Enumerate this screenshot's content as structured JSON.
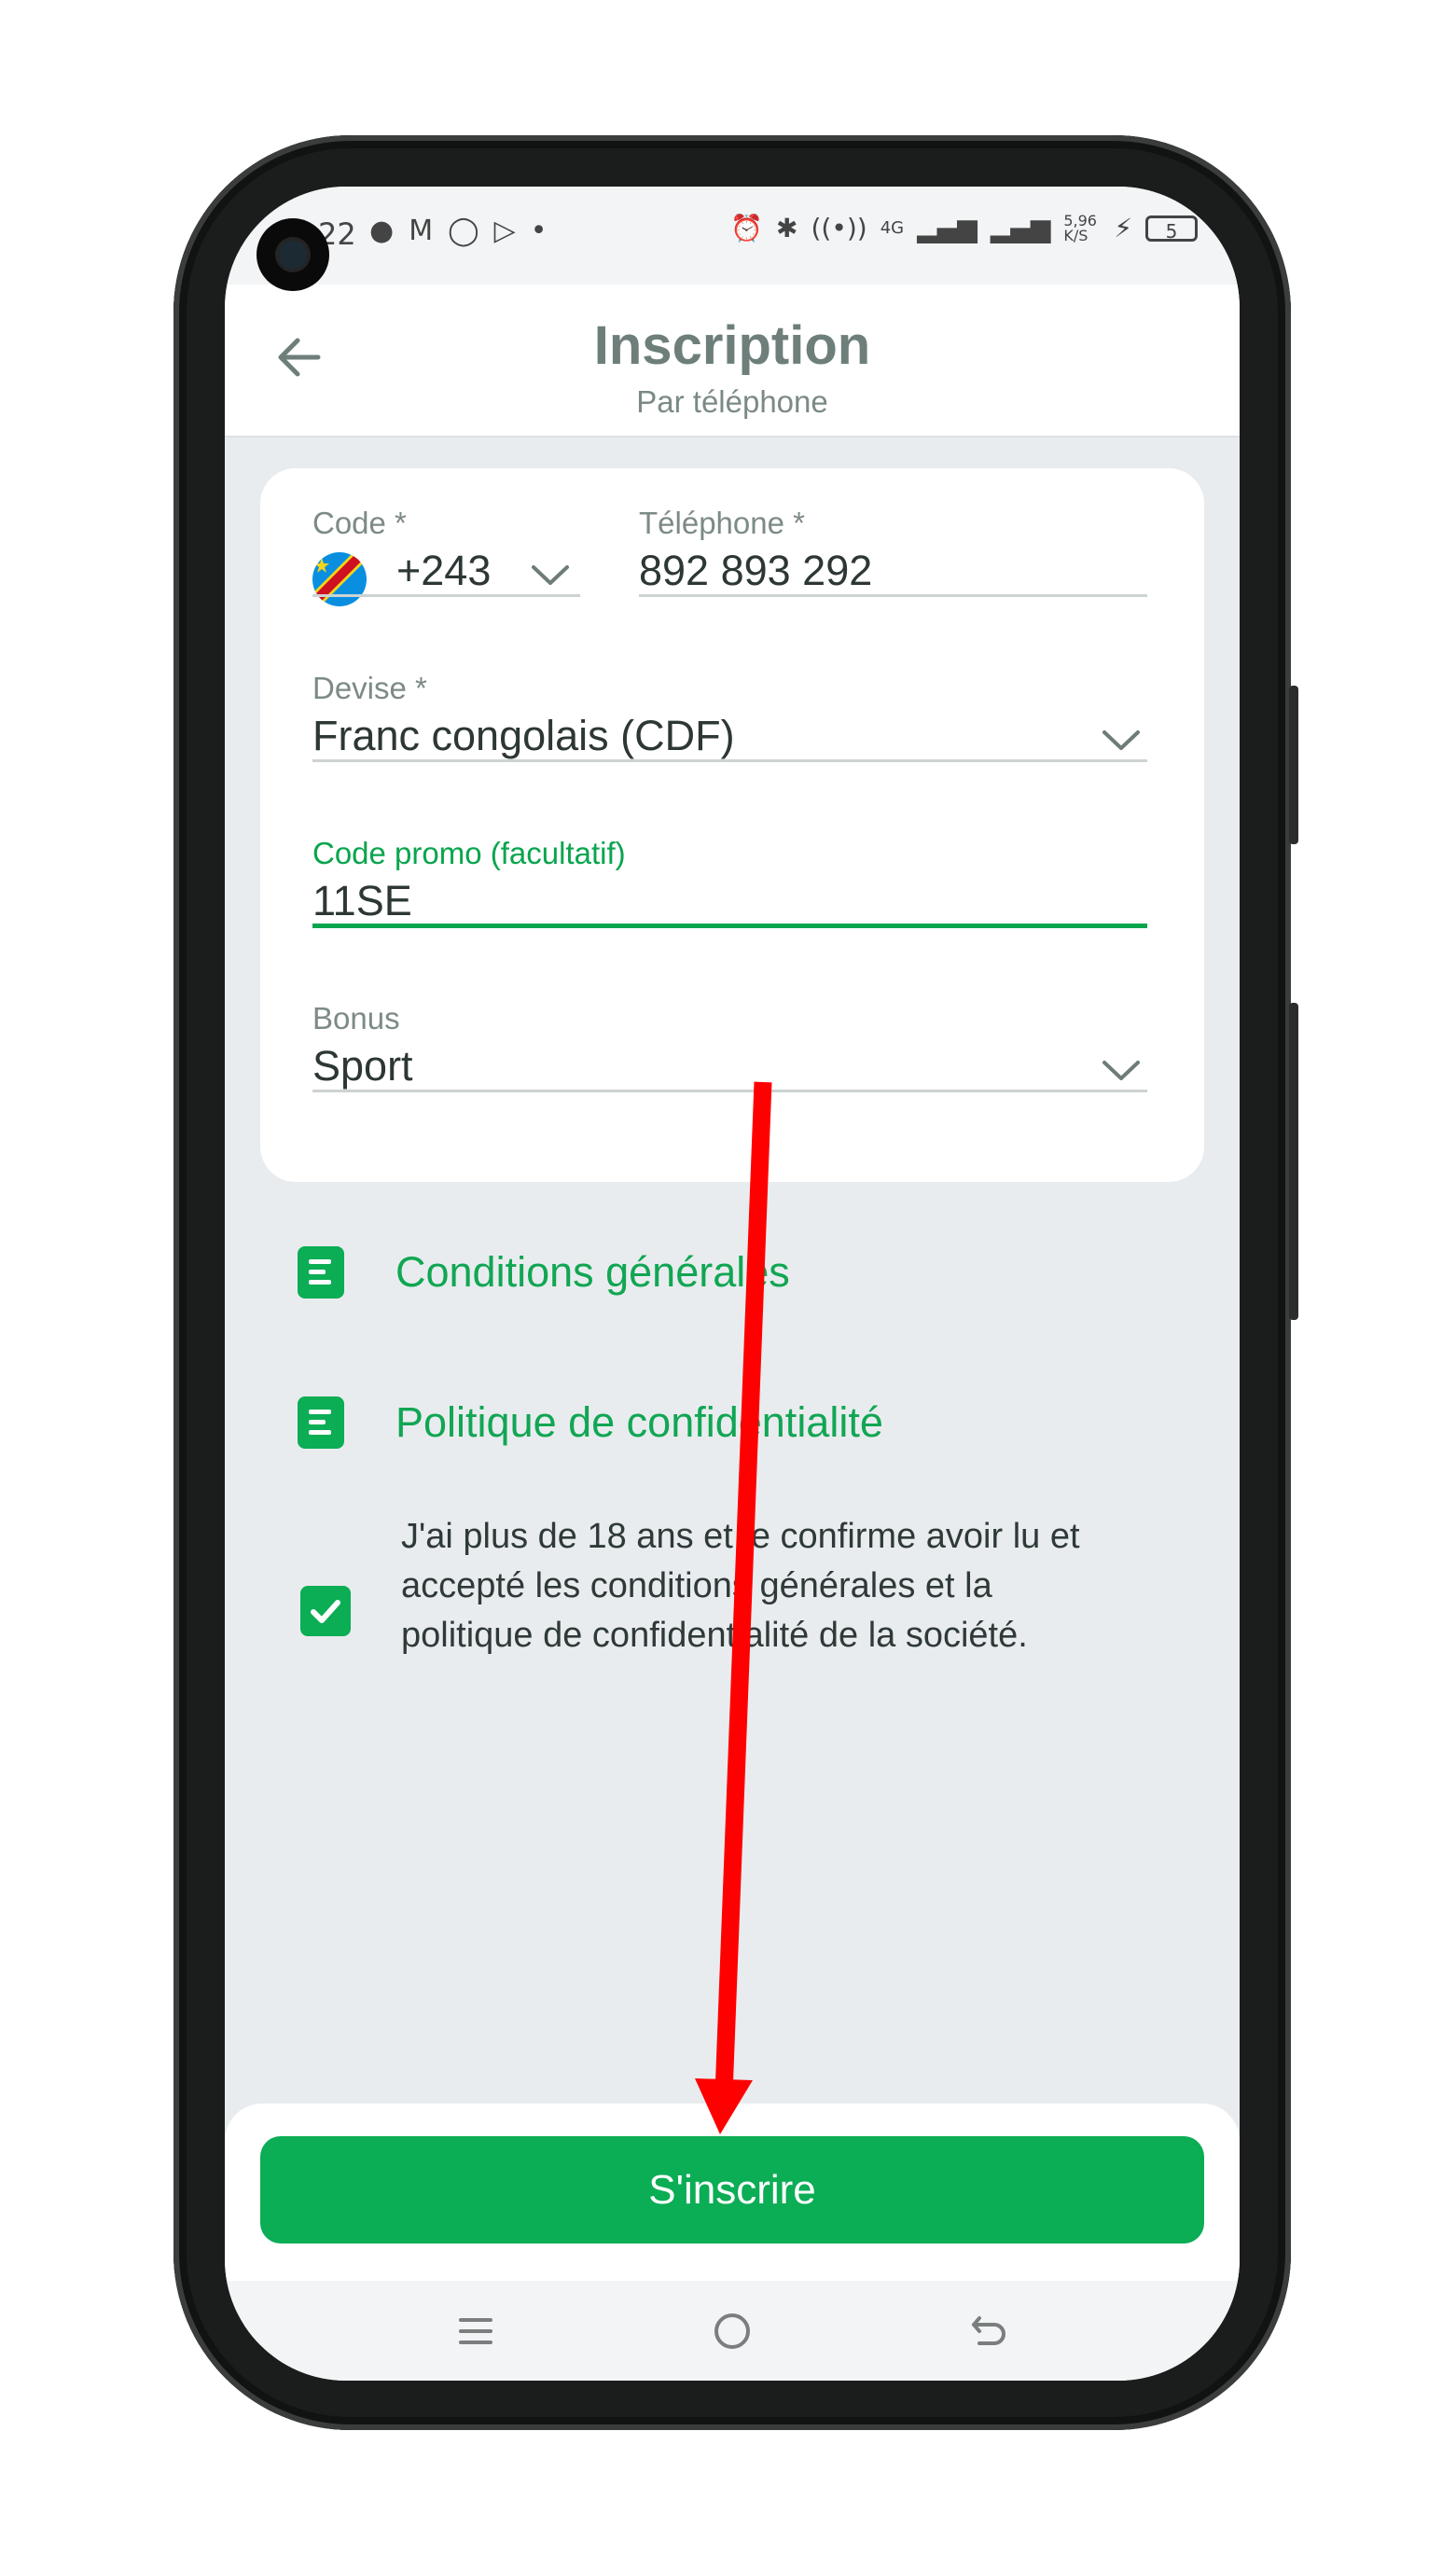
{
  "status_bar": {
    "time": "22",
    "battery": "5",
    "net_speed": "5,96 K/S",
    "network": "4G"
  },
  "header": {
    "title": "Inscription",
    "subtitle": "Par téléphone"
  },
  "form": {
    "code": {
      "label": "Code *",
      "value": "+243"
    },
    "phone": {
      "label": "Téléphone *",
      "value": "892 893 292"
    },
    "currency": {
      "label": "Devise *",
      "value": "Franc congolais (CDF)"
    },
    "promo": {
      "label": "Code promo (facultatif)",
      "value": "11SE"
    },
    "bonus": {
      "label": "Bonus",
      "value": "Sport"
    }
  },
  "links": {
    "terms": "Conditions générales",
    "privacy": "Politique de confidentialité"
  },
  "consent": {
    "checked": true,
    "text": "J'ai plus de 18 ans et je confirme avoir lu et accepté les conditions générales et la politique de confidentialité de la société."
  },
  "submit_label": "S'inscrire",
  "colors": {
    "accent": "#0bad55",
    "annotation_arrow": "#ff0000"
  }
}
